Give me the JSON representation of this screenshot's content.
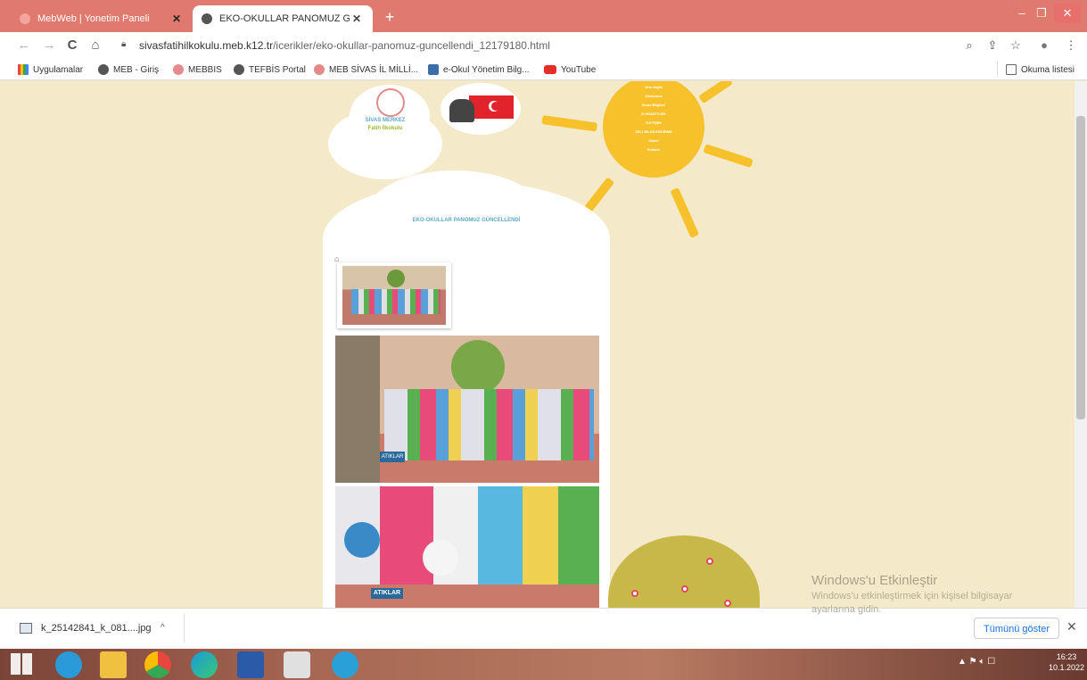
{
  "browser": {
    "tabs": [
      {
        "title": "MebWeb | Yonetim Paneli",
        "active": false
      },
      {
        "title": "EKO-OKULLAR PANOMUZ GÜNC",
        "active": true
      }
    ],
    "new_tab_label": "+",
    "window_controls": {
      "minimize": "–",
      "maximize": "❐",
      "close": "✕"
    },
    "nav": {
      "back": "←",
      "forward": "→",
      "reload": "C",
      "home": "⌂"
    },
    "address": {
      "domain": "sivasfatihilkokulu.meb.k12.tr",
      "path": "/icerikler/eko-okullar-panomuz-guncellendi_12179180.html"
    },
    "toolbar_icons": {
      "zoom": "⌕",
      "share": "⇪",
      "star": "☆",
      "profile": "●",
      "menu": "⋮"
    }
  },
  "bookmarks": [
    {
      "label": "Uygulamalar",
      "color": "#e8453c"
    },
    {
      "label": "MEB - Giriş",
      "color": "#555555"
    },
    {
      "label": "MEBBIS",
      "color": "#e58a8a"
    },
    {
      "label": "TEFBİS Portal",
      "color": "#555555"
    },
    {
      "label": "MEB SİVAS İL MİLLİ...",
      "color": "#e58a8a"
    },
    {
      "label": "e-Okul Yönetim Bilg...",
      "color": "#3a6ea8"
    },
    {
      "label": "YouTube",
      "color": "#e52d27"
    }
  ],
  "reading_list": "Okuma listesi",
  "page": {
    "school_line1": "SİVAS MERKEZ",
    "school_line2": "Fatih İlkokulu",
    "sun_menu": [
      "Ana Sayfa",
      "Okulumuz",
      "Sınav Bilgileri",
      "E-HİZMETLER",
      "İLETİŞİM",
      "VELİ BİLGİLENDİRME",
      "Galeri",
      "İletişim"
    ],
    "post_title": "EKO-OKULLAR PANOMUZ GÜNCELLENDİ",
    "home_crumb": "⌂",
    "banner_word": "ATIKLAR"
  },
  "activation": {
    "title": "Windows'u Etkinleştir",
    "line": "Windows'u etkinleştirmek için kişisel bilgisayar",
    "line2": "ayarlarına gidin."
  },
  "download": {
    "filename": "k_25142841_k_081....jpg",
    "chevron": "^",
    "show_all": "Tümünü göster",
    "close": "✕"
  },
  "taskbar": {
    "time": "16:23",
    "date": "10.1.2022"
  }
}
